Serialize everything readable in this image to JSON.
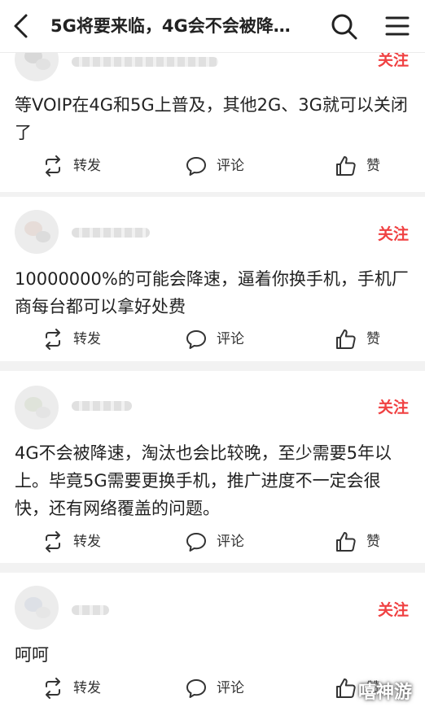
{
  "header": {
    "title": "5G将要来临，4G会不会被降…"
  },
  "actions": {
    "repost": "转发",
    "comment": "评论",
    "like": "赞"
  },
  "comments": [
    {
      "follow": "关注",
      "text": "等VOIP在4G和5G上普及，其他2G、3G就可以关闭了"
    },
    {
      "follow": "关注",
      "text": "10000000%的可能会降速，逼着你换手机，手机厂商每台都可以拿好处费"
    },
    {
      "follow": "关注",
      "text": "4G不会被降速，淘汰也会比较晚，至少需要5年以上。毕竟5G需要更换手机，推广进度不一定会很快，还有网络覆盖的问题。"
    },
    {
      "follow": "关注",
      "text": "呵呵"
    }
  ],
  "watermark": "嘻神游",
  "colors": {
    "accent": "#f04142"
  },
  "icons": [
    "back-arrow-icon",
    "search-icon",
    "more-icon",
    "repost-icon",
    "comment-icon",
    "like-icon"
  ]
}
